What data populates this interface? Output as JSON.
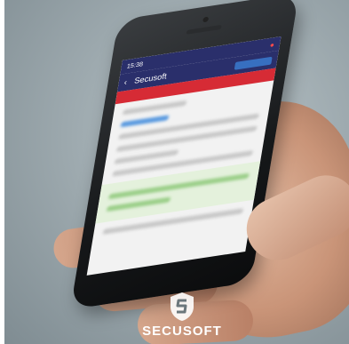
{
  "phone": {
    "status_time": "15:38",
    "nav_title": "Secusoft"
  },
  "brand": {
    "name": "SECUSOFT"
  },
  "colors": {
    "navbar": "#2a2f6b",
    "accent_red": "#d62b35",
    "accent_blue": "#3b7fd6",
    "accent_green": "#9ccf8a"
  },
  "icons": {
    "back": "chevron-left-icon",
    "notification": "bell-icon",
    "logo": "shield-s-logo"
  }
}
